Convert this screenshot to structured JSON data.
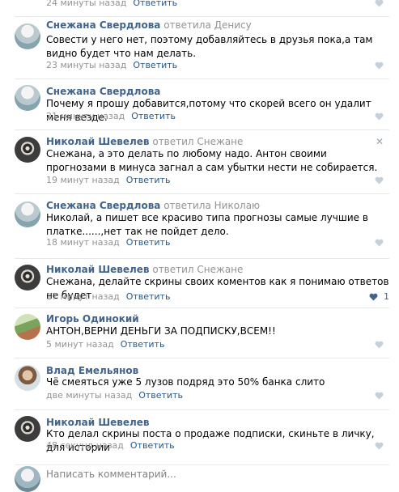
{
  "top_partial": {
    "time": "24 минуты назад",
    "reply_label": "Ответить"
  },
  "comments": [
    {
      "author": "Снежана Свердлова",
      "reply_to": "ответила Денису",
      "text": "Совести у него нет, поэтому добавляйтесь в друзья пока,а там видно будет что нам делать.",
      "time": "23 минуты назад",
      "reply_label": "Ответить",
      "avatar": "woman-photo"
    },
    {
      "author": "Снежана Свердлова",
      "reply_to": "",
      "text": "Почему я прошу добавится,потому что скорей всего он удалит меня везде.",
      "time": "21 минуту назад",
      "reply_label": "Ответить",
      "avatar": "woman-photo"
    },
    {
      "author": "Николай Шевелев",
      "reply_to": "ответил Снежане",
      "text": "Снежана, а это делать по любому надо. Антон своими прогнозами в минуса загнал а сам убытки нести не собирается.",
      "time": "19 минут назад",
      "reply_label": "Ответить",
      "avatar": "raccoon-photo"
    },
    {
      "author": "Снежана Свердлова",
      "reply_to": "ответила Николаю",
      "text": "Николай, а пишет все красиво типа прогнозы самые лучшие в платке......,нет так не пойдет дело.",
      "time": "18 минут назад",
      "reply_label": "Ответить",
      "avatar": "woman-photo"
    },
    {
      "author": "Николай Шевелев",
      "reply_to": "ответил Снежане",
      "text": "Снежана, делайте скрины своих коментов как я понимаю ответов не будет",
      "time": "17 минут назад",
      "reply_label": "Ответить",
      "avatar": "raccoon-photo",
      "likes": "1"
    },
    {
      "author": "Игорь Одинокий",
      "reply_to": "",
      "text": "АНТОН,ВЕРНИ ДЕНЬГИ ЗА ПОДПИСКУ,ВСЕМ!!",
      "time": "5 минут назад",
      "reply_label": "Ответить",
      "avatar": "outdoor-photo"
    },
    {
      "author": "Влад Емельянов",
      "reply_to": "",
      "text": "Чё смеяться уже 5 лузов подряд это 50% банка слито",
      "time": "две минуты назад",
      "reply_label": "Ответить",
      "avatar": "man-photo"
    },
    {
      "author": "Николай Шевелев",
      "reply_to": "",
      "text": "Кто делал скрины поста о продаже подписки, скиньте в личку, для истории",
      "time": "48 секунд назад",
      "reply_label": "Ответить",
      "avatar": "raccoon-photo"
    }
  ],
  "composer": {
    "placeholder": "Написать комментарий..."
  },
  "colors": {
    "link": "#2a5885",
    "name": "#42648b",
    "meta": "#939393",
    "heart": "#c5d0db",
    "separator": "#e7e8ec"
  }
}
